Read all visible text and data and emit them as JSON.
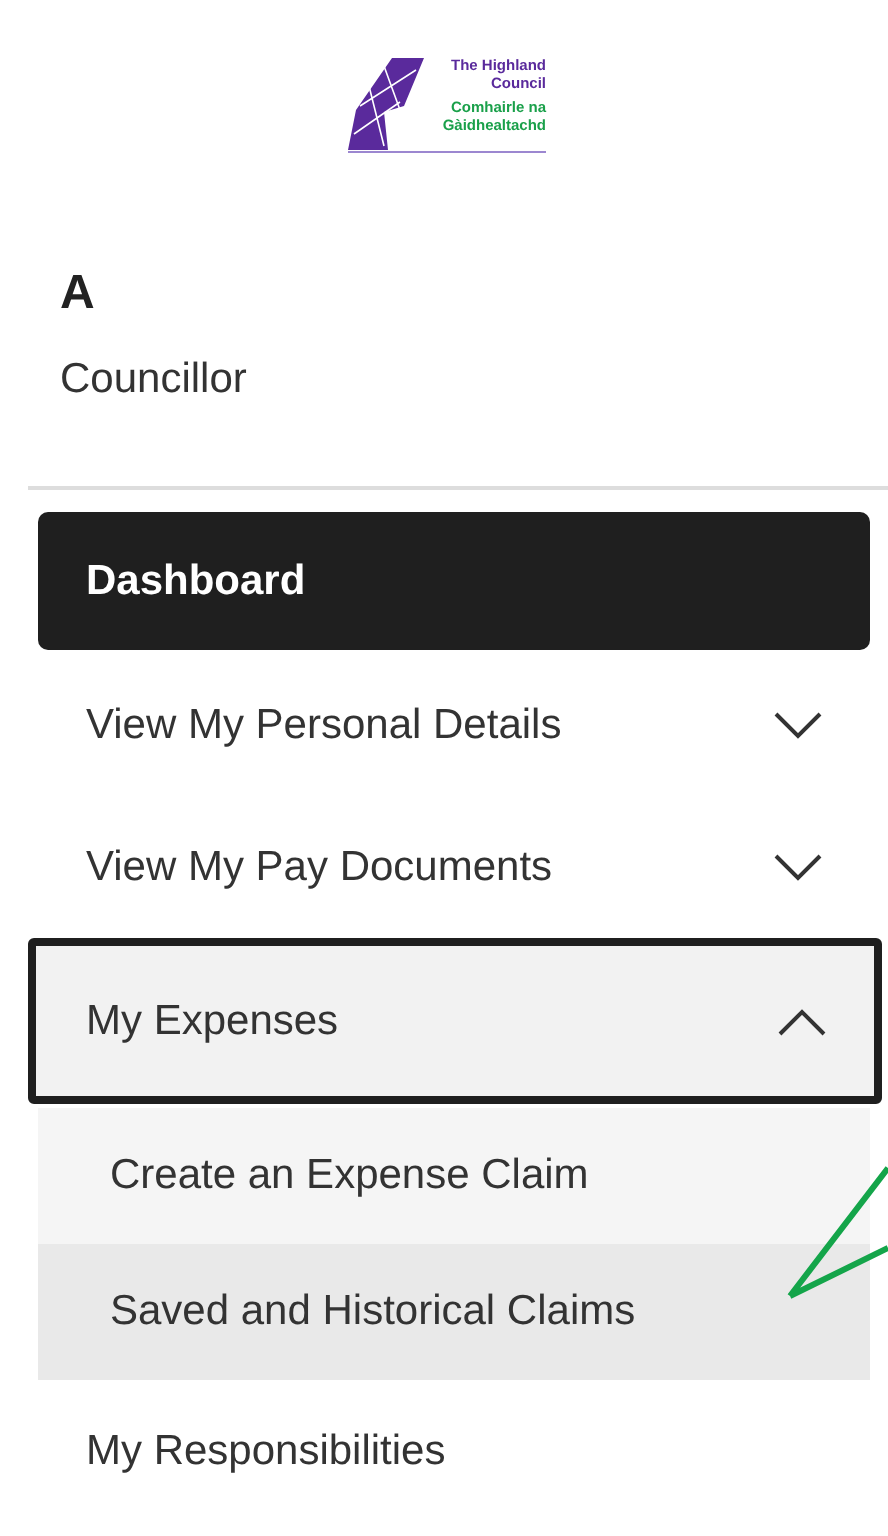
{
  "logo": {
    "title": [
      "The Highland",
      "Council"
    ],
    "subtitle": [
      "Comhairle na",
      "Gàidhealtachd"
    ]
  },
  "user": {
    "name": "A",
    "role": "Councillor"
  },
  "nav": [
    {
      "label": "Dashboard",
      "kind": "link",
      "selected": true
    },
    {
      "label": "View My Personal Details",
      "kind": "group",
      "expanded": false,
      "selected": false
    },
    {
      "label": "View My Pay Documents",
      "kind": "group",
      "expanded": false,
      "selected": false
    },
    {
      "label": "My Expenses",
      "kind": "group",
      "expanded": true,
      "selected": false,
      "children": [
        {
          "label": "Create an Expense Claim",
          "selected": false
        },
        {
          "label": "Saved and Historical Claims",
          "selected": true
        }
      ]
    },
    {
      "label": "My Responsibilities",
      "kind": "link",
      "selected": false
    }
  ]
}
